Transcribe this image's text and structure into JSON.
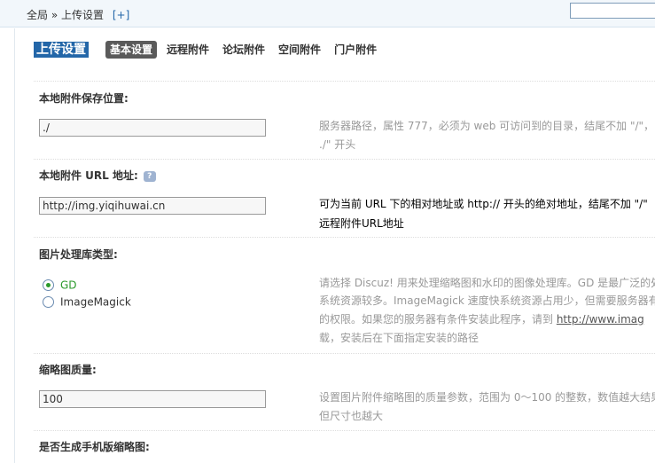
{
  "breadcrumb": {
    "root": "全局",
    "sep": "»",
    "current": "上传设置",
    "add": "[+]"
  },
  "page": {
    "title": "上传设置",
    "tabs": [
      "基本设置",
      "远程附件",
      "论坛附件",
      "空间附件",
      "门户附件"
    ]
  },
  "settings": {
    "local_path": {
      "label": "本地附件保存位置:",
      "value": "./",
      "tip_line1": "服务器路径，属性 777，必须为 web 可访问到的目录，结尾不加 \"/\"，",
      "tip_line2": "./\" 开头"
    },
    "local_url": {
      "label": "本地附件 URL 地址:",
      "help": "?",
      "value": "http://img.yiqihuwai.cn",
      "tip_line1": "可为当前 URL 下的相对地址或 http:// 开头的绝对地址，结尾不加 \"/\"",
      "tip_line2": "远程附件URL地址"
    },
    "image_lib": {
      "label": "图片处理库类型:",
      "options": [
        "GD",
        "ImageMagick"
      ],
      "selected": "GD",
      "tip_line1": "请选择 Discuz! 用来处理缩略图和水印的图像处理库。GD 是最广泛的处",
      "tip_line2": "系统资源较多。ImageMagick 速度快系统资源占用少，但需要服务器有",
      "tip_line3_a": "的权限。如果您的服务器有条件安装此程序，请到 ",
      "tip_line3_link": "http://www.imag",
      "tip_line4": "载，安装后在下面指定安装的路径"
    },
    "thumb_quality": {
      "label": "缩略图质量:",
      "value": "100",
      "tip_line1": "设置图片附件缩略图的质量参数，范围为 0～100 的整数，数值越大结果",
      "tip_line2": "但尺寸也越大"
    },
    "mobile_thumb": {
      "label": "是否生成手机版缩略图:"
    }
  }
}
